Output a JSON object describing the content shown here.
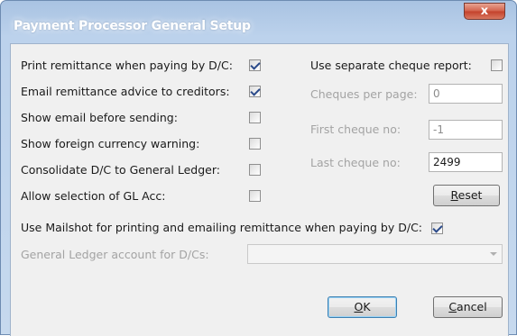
{
  "window": {
    "title": "Payment Processor General Setup",
    "close_glyph": "x"
  },
  "left_options": [
    {
      "label": "Print remittance when paying by D/C:",
      "checked": true
    },
    {
      "label": "Email remittance advice to creditors:",
      "checked": true
    },
    {
      "label": "Show email before sending:",
      "checked": false
    },
    {
      "label": "Show foreign currency warning:",
      "checked": false
    },
    {
      "label": "Consolidate D/C to General Ledger:",
      "checked": false
    },
    {
      "label": "Allow selection of GL Acc:",
      "checked": false
    }
  ],
  "right": {
    "separate_cheque_label": "Use separate cheque report:",
    "separate_cheque_checked": false,
    "cheques_per_page_label": "Cheques per page:",
    "cheques_per_page_value": "0",
    "first_cheque_label": "First cheque no:",
    "first_cheque_value": "-1",
    "last_cheque_label": "Last cheque no:",
    "last_cheque_value": "2499",
    "reset_mnemonic": "R",
    "reset_rest": "eset"
  },
  "mailshot": {
    "label": "Use Mailshot for printing and emailing remittance when paying by D/C:",
    "checked": true
  },
  "gl_account": {
    "label": "General Ledger account for D/Cs:",
    "value": ""
  },
  "buttons": {
    "ok_mnemonic": "O",
    "ok_rest": "K",
    "cancel_mnemonic": "C",
    "cancel_rest": "ancel"
  },
  "colors": {
    "title_bar": "#bcd2ec",
    "close_button": "#c4412b",
    "client_area": "#f0f0f0",
    "check_mark": "#2b4a8a",
    "disabled_text": "#a3a3a3"
  }
}
